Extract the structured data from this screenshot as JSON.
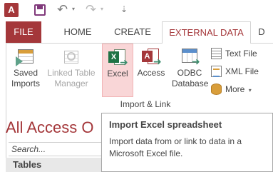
{
  "qat": {
    "app_badge": "A",
    "undo_glyph": "↶",
    "redo_glyph": "↷",
    "caret_glyph": "▾",
    "customize_glyph": "⇣"
  },
  "tabs": [
    {
      "label": "FILE"
    },
    {
      "label": "HOME"
    },
    {
      "label": "CREATE"
    },
    {
      "label": "EXTERNAL DATA"
    },
    {
      "label": "D"
    }
  ],
  "ribbon": {
    "saved_imports": {
      "line1": "Saved",
      "line2": "Imports"
    },
    "linked_table_manager": {
      "line1": "Linked Table",
      "line2": "Manager"
    },
    "excel": {
      "label": "Excel",
      "badge": "X"
    },
    "access": {
      "label": "Access",
      "badge": "A"
    },
    "odbc": {
      "line1": "ODBC",
      "line2": "Database"
    },
    "text_file": "Text File",
    "xml_file": "XML File",
    "more": "More",
    "more_caret": "▾",
    "group_label": "Import & Link",
    "arrow_glyph": "➜"
  },
  "nav": {
    "title": "All Access O",
    "search_placeholder": "Search...",
    "section": "Tables"
  },
  "tooltip": {
    "title": "Import Excel spreadsheet",
    "body": "Import data from or link to data in a Microsoft Excel file."
  },
  "colors": {
    "accent": "#a4373a",
    "excel_green": "#207245",
    "excel_highlight": "#f9d6d7"
  }
}
